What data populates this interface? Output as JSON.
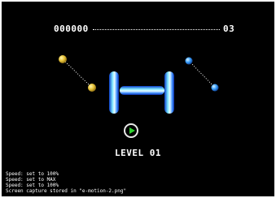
{
  "hud": {
    "score": "000000",
    "lives": "03"
  },
  "level_label": "LEVEL 01",
  "play_icon": "play-icon",
  "colors": {
    "background": "#000000",
    "tube_blue": "#1e6bff",
    "tube_glow": "#b8f4ff",
    "yellow_node": "#e8c43a",
    "blue_node": "#3aa0ff",
    "play_green": "#2fd12f"
  },
  "log_lines": [
    "Speed: set to 100%",
    "Speed: set to MAX",
    "Speed: set to 100%",
    "Screen capture stored in \"e-motion-2.png\""
  ]
}
